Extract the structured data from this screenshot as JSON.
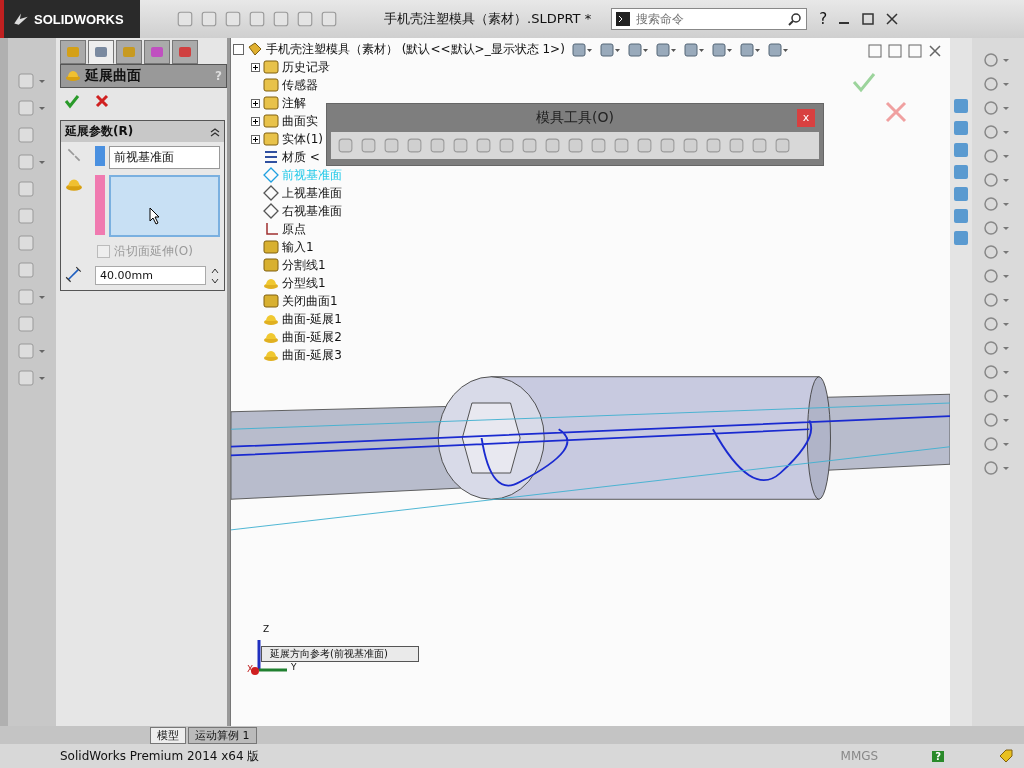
{
  "title_bar": {
    "logo": "SOLIDWORKS",
    "document_title": "手机壳注塑模具（素材）.SLDPRT *",
    "search": {
      "placeholder": "搜索命令"
    },
    "help": "?"
  },
  "manager_tabs": [
    {
      "kind": "feature",
      "selected": false
    },
    {
      "kind": "property",
      "selected": true
    },
    {
      "kind": "config",
      "selected": false
    },
    {
      "kind": "dim",
      "selected": false
    },
    {
      "kind": "display",
      "selected": false
    }
  ],
  "property_manager": {
    "title": "延展曲面",
    "help": "?",
    "group": {
      "title": "延展参数(R)",
      "expanded": true
    },
    "reference_plane": "前视基准面",
    "tangent_checkbox": {
      "label": "沿切面延伸(O)",
      "checked": false,
      "disabled": true
    },
    "distance": "40.00mm"
  },
  "feature_tree": {
    "root": "手机壳注塑模具（素材） (默认<<默认>_显示状态 1>)",
    "children": [
      {
        "label": "历史记录",
        "kind": "folder",
        "expandable": true,
        "selected": false
      },
      {
        "label": "传感器",
        "kind": "folder",
        "expandable": false,
        "selected": false
      },
      {
        "label": "注解",
        "kind": "folder",
        "expandable": true,
        "selected": false
      },
      {
        "label": "曲面实",
        "kind": "folder",
        "expandable": true,
        "selected": false
      },
      {
        "label": "实体(1)",
        "kind": "folder",
        "expandable": true,
        "selected": false
      },
      {
        "label": "材质 <",
        "kind": "material",
        "expandable": false,
        "selected": false
      },
      {
        "label": "前视基准面",
        "kind": "plane",
        "expandable": false,
        "selected": true
      },
      {
        "label": "上视基准面",
        "kind": "plane",
        "expandable": false,
        "selected": false
      },
      {
        "label": "右视基准面",
        "kind": "plane",
        "expandable": false,
        "selected": false
      },
      {
        "label": "原点",
        "kind": "origin",
        "expandable": false,
        "selected": false
      },
      {
        "label": "输入1",
        "kind": "feature",
        "expandable": false,
        "selected": false
      },
      {
        "label": "分割线1",
        "kind": "feature",
        "expandable": false,
        "selected": false
      },
      {
        "label": "分型线1",
        "kind": "surface",
        "expandable": false,
        "selected": false
      },
      {
        "label": "关闭曲面1",
        "kind": "feature",
        "expandable": false,
        "selected": false
      },
      {
        "label": "曲面-延展1",
        "kind": "surface",
        "expandable": false,
        "selected": false
      },
      {
        "label": "曲面-延展2",
        "kind": "surface",
        "expandable": false,
        "selected": false
      },
      {
        "label": "曲面-延展3",
        "kind": "surface",
        "expandable": false,
        "selected": false
      }
    ]
  },
  "mold_toolbar": {
    "title": "模具工具(O)",
    "close": "x"
  },
  "viewport": {
    "callout": "延展方向参考(前视基准面)",
    "axes": {
      "z": "Z",
      "x": "X",
      "y": "Y"
    }
  },
  "bottom_tabs": [
    {
      "label": "模型",
      "selected": true
    },
    {
      "label": "运动算例 1",
      "selected": false
    }
  ],
  "status_bar": {
    "product": "SolidWorks Premium 2014 x64 版",
    "units": "MMGS",
    "help": "?"
  }
}
